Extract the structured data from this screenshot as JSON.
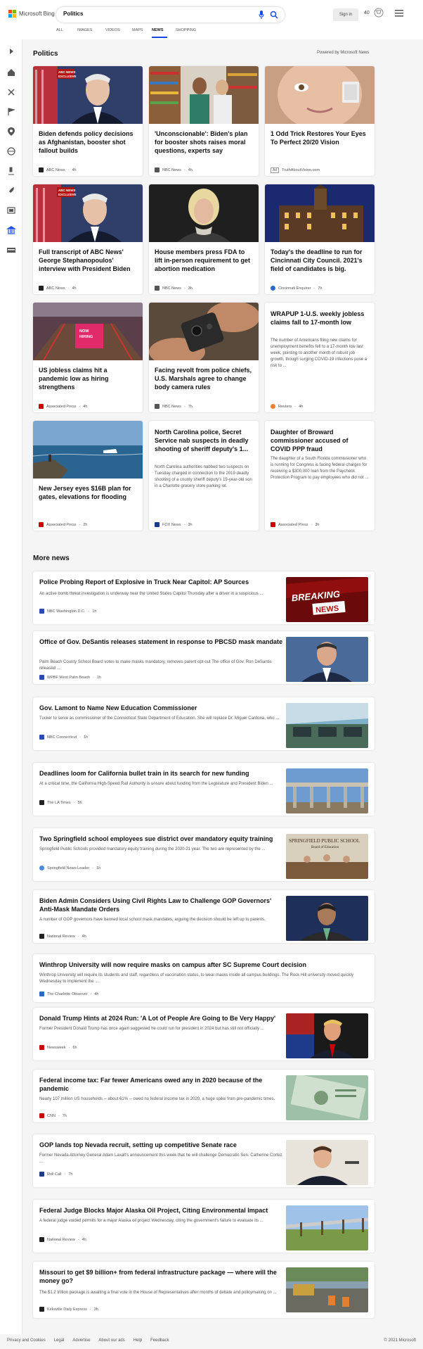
{
  "header": {
    "logo_text": "Microsoft Bing",
    "search_query": "Politics",
    "signin_label": "Sign in",
    "points": "40",
    "tabs": [
      "ALL",
      "IMAGES",
      "VIDEOS",
      "MAPS",
      "NEWS",
      "SHOPPING"
    ],
    "active_tab": "NEWS"
  },
  "section": {
    "title": "Politics",
    "powered": "Powered by Microsoft News"
  },
  "cards": [
    {
      "title": "Biden defends policy decisions as Afghanistan, booster shot fallout builds",
      "source": "ABC News",
      "time": "4h",
      "desc": ""
    },
    {
      "title": "'Unconscionable': Biden's plan for booster shots raises moral questions, experts say",
      "source": "NBC News",
      "time": "4h",
      "desc": ""
    },
    {
      "title": "1 Odd Trick Restores Your Eyes To Perfect 20/20 Vision",
      "source": "TruthAboutVision.com",
      "time": "",
      "ad": "Ad",
      "desc": ""
    },
    {
      "title": "Full transcript of ABC News' George Stephanopoulos' interview with President Biden",
      "source": "ABC News",
      "time": "4h",
      "desc": ""
    },
    {
      "title": "House members press FDA to lift in-person requirement to get abortion medication",
      "source": "NBC News",
      "time": "3h",
      "desc": ""
    },
    {
      "title": "Today's the deadline to run for Cincinnati City Council. 2021's field of candidates is big.",
      "source": "Cincinnati Enquirer",
      "time": "7h",
      "desc": ""
    },
    {
      "title": "US jobless claims hit a pandemic low as hiring strengthens",
      "source": "Associated Press",
      "time": "4h",
      "desc": ""
    },
    {
      "title": "Facing revolt from police chiefs, U.S. Marshals agree to change body camera rules",
      "source": "NBC News",
      "time": "7h",
      "desc": ""
    },
    {
      "title": "WRAPUP 1-U.S. weekly jobless claims fall to 17-month low",
      "source": "Reuters",
      "time": "4h",
      "desc": "The number of Americans filing new claims for unemployment benefits fell to a 17-month low last week, pointing to another month of robust job growth, though surging COVID-19 infections pose a risk to ..."
    },
    {
      "title": "New Jersey eyes $16B plan for gates, elevations for flooding",
      "source": "Associated Press",
      "time": "2h",
      "desc": ""
    },
    {
      "title": "North Carolina police, Secret Service nab suspects in deadly shooting of sheriff deputy's 1...",
      "source": "FOX News",
      "time": "3h",
      "desc": "North Carolina authorities nabbed two suspects on Tuesday charged in connection to the 2019 deadly shooting of a county sheriff deputy's 19-year-old son in a Charlotte grocery store parking lot."
    },
    {
      "title": "Daughter of Broward commissioner accused of COVID PPP fraud",
      "source": "Associated Press",
      "time": "3h",
      "desc": "The daughter of a South Florida commissioner who is running for Congress is facing federal charges for receiving a $300,000 loan from the Paycheck Protection Program to pay employees who did not ..."
    }
  ],
  "more_news": {
    "title": "More news",
    "items": [
      {
        "title": "Police Probing Report of Explosive in Truck Near Capitol: AP Sources",
        "desc": "An active bomb threat investigation is underway near the United States Capitol Thursday after a driver in a suspicious ...",
        "source": "NBC Washington D.C.",
        "time": "1h",
        "thumb_text": "BREAKING NEWS"
      },
      {
        "title": "Office of Gov. DeSantis releases statement in response to PBCSD mask mandate",
        "desc": "Palm Beach County School Board votes to make masks mandatory, removes parent opt-out The office of Gov. Ron DeSantis released ...",
        "source": "WPBF West Palm Beach",
        "time": "1h"
      },
      {
        "title": "Gov. Lamont to Name New Education Commissioner",
        "desc": "Tucker to serve as commissioner of the Connecticut State Department of Education. She will replace Dr. Miguel Cardona, who ...",
        "source": "NBC Connecticut",
        "time": "1h"
      },
      {
        "title": "Deadlines loom for California bullet train in its search for new funding",
        "desc": "At a critical time, the California High-Speed Rail Authority is unsure about funding from the Legislature and President Biden ...",
        "source": "The LA Times",
        "time": "5h"
      },
      {
        "title": "Two Springfield school employees sue district over mandatory equity training",
        "desc": "Springfield Public Schools provided mandatory equity training during the 2020-21 year. The two are represented by the ...",
        "source": "Springfield News-Leader",
        "time": "1h",
        "thumb_text": "SPRINGFIELD PUBLIC SCHOOL",
        "thumb_sub": "Board of Education"
      },
      {
        "title": "Biden Admin Considers Using Civil Rights Law to Challenge GOP Governors' Anti-Mask Mandate Orders",
        "desc": "A number of GOP governors have banned local school mask mandates, arguing the decision should be left up to parents.",
        "source": "National Review",
        "time": "4h"
      },
      {
        "title": "Winthrop University will now require masks on campus after SC Supreme Court decision",
        "desc": "Winthrop University will require its students and staff, regardless of vaccination status, to wear masks inside all campus buildings. The Rock Hill university moved quickly Wednesday to implement the ...",
        "source": "The Charlotte Observer",
        "time": "4h"
      },
      {
        "title": "Donald Trump Hints at 2024 Run: 'A Lot of People Are Going to Be Very Happy'",
        "desc": "Former President Donald Trump has once again suggested he could run for president in 2024 but has still not officially ...",
        "source": "Newsweek",
        "time": "6h"
      },
      {
        "title": "Federal income tax: Far fewer Americans owed any in 2020 because of the pandemic",
        "desc": "Nearly 107 million US households -- about 61% -- owed no federal income tax in 2020, a huge spike from pre-pandemic times.",
        "source": "CNN",
        "time": "7h"
      },
      {
        "title": "GOP lands top Nevada recruit, setting up competitive Senate race",
        "desc": "Former Nevada Attorney General Adam Laxalt's announcement this week that he will challenge Democratic Sen. Catherine Cortez ...",
        "source": "Roll Call",
        "time": "7h"
      },
      {
        "title": "Federal Judge Blocks Major Alaska Oil Project, Citing Environmental Impact",
        "desc": "A federal judge voided permits for a major Alaska oil project Wednesday, citing the government's failure to evaluate its ...",
        "source": "National Review",
        "time": "4h"
      },
      {
        "title": "Missouri to get $9 billion+ from federal infrastructure package — where will the money go?",
        "desc": "The $1.2 trillion package is awaiting a final vote in the House of Representatives after months of debate and policymaking on ...",
        "source": "Kirksville Daily Express",
        "time": "3h"
      }
    ]
  },
  "footer": {
    "links": [
      "Privacy and Cookies",
      "Legal",
      "Advertise",
      "About our ads",
      "Help",
      "Feedback"
    ],
    "copyright": "© 2021 Microsoft"
  },
  "colors": {
    "accent": "#174ae4",
    "bing_red": "#f25022",
    "bing_green": "#7fba00",
    "bing_blue": "#00a4ef",
    "bing_yellow": "#ffb900"
  }
}
